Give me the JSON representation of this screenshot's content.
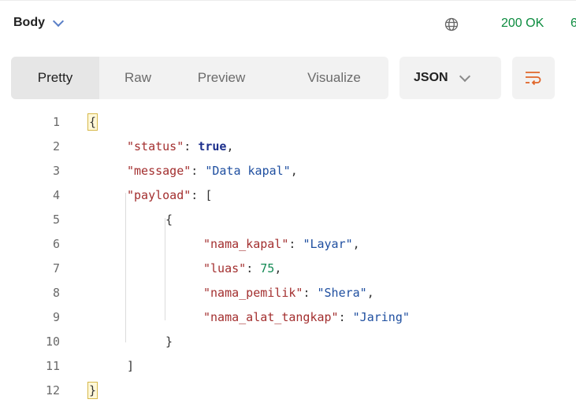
{
  "header": {
    "body_label": "Body",
    "status": "200 OK",
    "status_extra": "6"
  },
  "toolbar": {
    "tabs": [
      {
        "label": "Pretty"
      },
      {
        "label": "Raw"
      },
      {
        "label": "Preview"
      },
      {
        "label": "Visualize"
      }
    ],
    "format_label": "JSON"
  },
  "code": {
    "line_numbers": [
      "1",
      "2",
      "3",
      "4",
      "5",
      "6",
      "7",
      "8",
      "9",
      "10",
      "11",
      "12"
    ],
    "l1_open": "{",
    "l2_key": "\"status\"",
    "l2_sep": ": ",
    "l2_val": "true",
    "l2_end": ",",
    "l3_key": "\"message\"",
    "l3_sep": ": ",
    "l3_val": "\"Data kapal\"",
    "l3_end": ",",
    "l4_key": "\"payload\"",
    "l4_sep": ": ",
    "l4_val": "[",
    "l5_open": "{",
    "l6_key": "\"nama_kapal\"",
    "l6_sep": ": ",
    "l6_val": "\"Layar\"",
    "l6_end": ",",
    "l7_key": "\"luas\"",
    "l7_sep": ": ",
    "l7_val": "75",
    "l7_end": ",",
    "l8_key": "\"nama_pemilik\"",
    "l8_sep": ": ",
    "l8_val": "\"Shera\"",
    "l8_end": ",",
    "l9_key": "\"nama_alat_tangkap\"",
    "l9_sep": ": ",
    "l9_val": "\"Jaring\"",
    "l10_close": "}",
    "l11_close": "]",
    "l12_close": "}"
  }
}
